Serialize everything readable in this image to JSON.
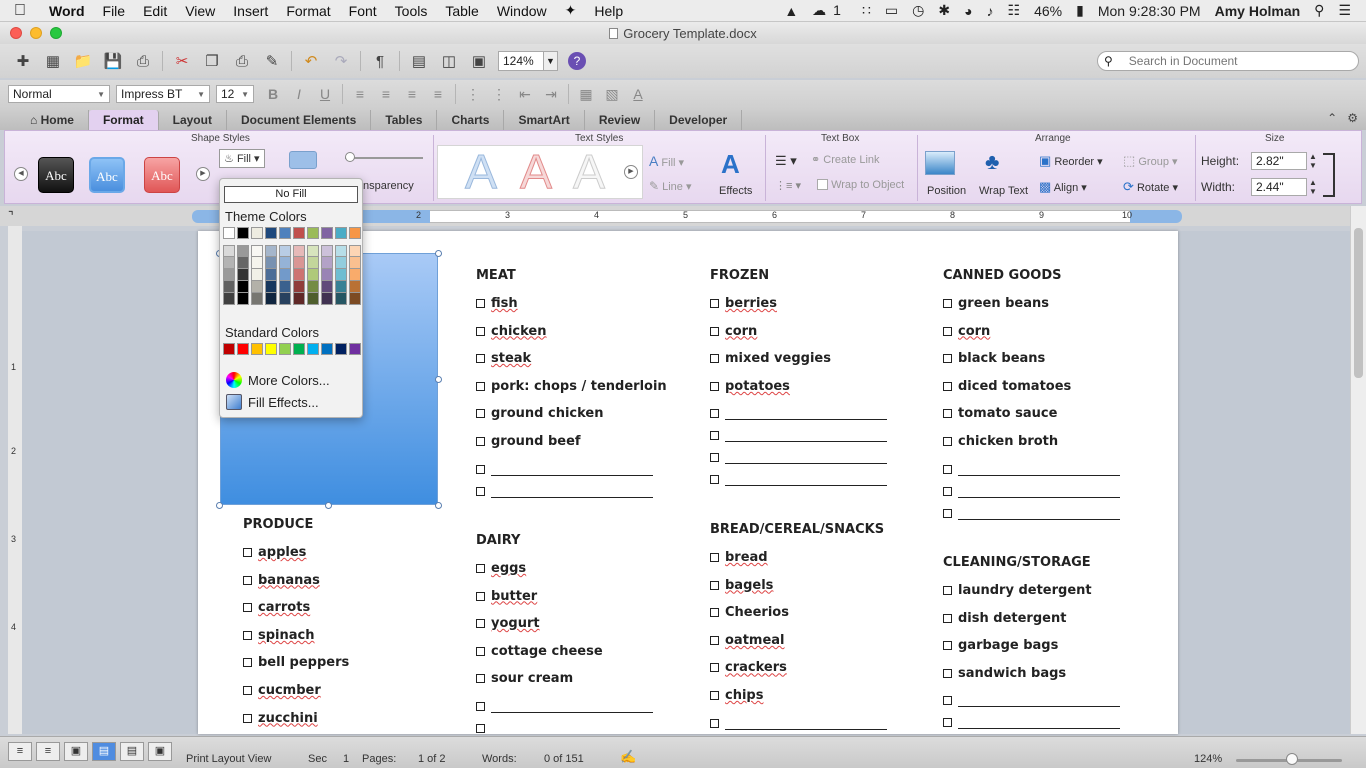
{
  "menubar": {
    "items": [
      "Word",
      "File",
      "Edit",
      "View",
      "Insert",
      "Format",
      "Font",
      "Tools",
      "Table",
      "Window",
      "Help"
    ],
    "battery": "46%",
    "clock": "Mon 9:28:30 PM",
    "user": "Amy Holman",
    "notif_count": "1"
  },
  "window": {
    "title": "Grocery Template.docx"
  },
  "toolbar": {
    "zoom": "124%",
    "search_placeholder": "Search in Document"
  },
  "format_bar": {
    "style": "Normal",
    "font": "Impress BT",
    "size": "12"
  },
  "ribbon": {
    "tabs": [
      "Home",
      "Format",
      "Layout",
      "Document Elements",
      "Tables",
      "Charts",
      "SmartArt",
      "Review",
      "Developer"
    ],
    "active_tab": "Format",
    "groups": {
      "shape_styles": "Shape Styles",
      "text_styles": "Text Styles",
      "text_box": "Text Box",
      "arrange": "Arrange",
      "size": "Size"
    },
    "abc_label": "Abc",
    "fill_label": "Fill",
    "transparency_label": "nsparency",
    "text_fill": "Fill",
    "text_line": "Line",
    "effects": "Effects",
    "create_link": "Create Link",
    "wrap_to_object": "Wrap to Object",
    "position": "Position",
    "wrap_text": "Wrap Text",
    "reorder": "Reorder",
    "align": "Align",
    "group": "Group",
    "rotate": "Rotate",
    "height_label": "Height:",
    "height_value": "2.82\"",
    "width_label": "Width:",
    "width_value": "2.44\""
  },
  "ruler": {
    "numbers": [
      "2",
      "3",
      "4",
      "5",
      "6",
      "7",
      "8",
      "9",
      "10"
    ]
  },
  "vruler": {
    "numbers": [
      "1",
      "2",
      "3",
      "4"
    ]
  },
  "fill_popup": {
    "no_fill": "No Fill",
    "theme_colors": "Theme Colors",
    "standard_colors": "Standard Colors",
    "more_colors": "More Colors...",
    "fill_effects": "Fill Effects...",
    "theme_top": [
      "#ffffff",
      "#000000",
      "#eeece1",
      "#1f497d",
      "#4f81bd",
      "#c0504d",
      "#9bbb59",
      "#8064a2",
      "#4bacc6",
      "#f79646"
    ],
    "standard": [
      "#c00000",
      "#ff0000",
      "#ffc000",
      "#ffff00",
      "#92d050",
      "#00b050",
      "#00b0f0",
      "#0070c0",
      "#002060",
      "#7030a0"
    ]
  },
  "lists": {
    "meat": {
      "title": "MEAT",
      "items": [
        "fish",
        "chicken",
        "steak",
        "pork: chops / tenderloin",
        "ground chicken",
        "ground beef"
      ]
    },
    "frozen": {
      "title": "FROZEN",
      "items": [
        "berries",
        "corn",
        "mixed veggies",
        "potatoes"
      ]
    },
    "canned": {
      "title": "CANNED GOODS",
      "items": [
        "green beans",
        "corn",
        "black beans",
        "diced tomatoes",
        "tomato sauce",
        "chicken broth"
      ]
    },
    "produce": {
      "title": "PRODUCE",
      "items": [
        "apples",
        "bananas",
        "carrots",
        "spinach",
        "bell peppers",
        "cucmber",
        "zucchini"
      ]
    },
    "dairy": {
      "title": "DAIRY",
      "items": [
        "eggs",
        "butter",
        "yogurt",
        "cottage cheese",
        "sour cream"
      ]
    },
    "bread": {
      "title": "BREAD/CEREAL/SNACKS",
      "items": [
        "bread",
        "bagels",
        "Cheerios",
        "oatmeal",
        "crackers",
        "chips"
      ]
    },
    "cleaning": {
      "title": "CLEANING/STORAGE",
      "items": [
        "laundry detergent",
        "dish detergent",
        "garbage bags",
        "sandwich bags"
      ]
    }
  },
  "status": {
    "view": "Print Layout View",
    "sec_label": "Sec",
    "sec_value": "1",
    "pages_label": "Pages:",
    "pages_value": "1 of 2",
    "words_label": "Words:",
    "words_value": "0 of 151",
    "zoom": "124%"
  },
  "colors": {
    "accent": "#4f8ce0",
    "ribbon": "#e7d8ef",
    "shape_top": "#a9caf6",
    "shape_bottom": "#3f8ee0"
  }
}
